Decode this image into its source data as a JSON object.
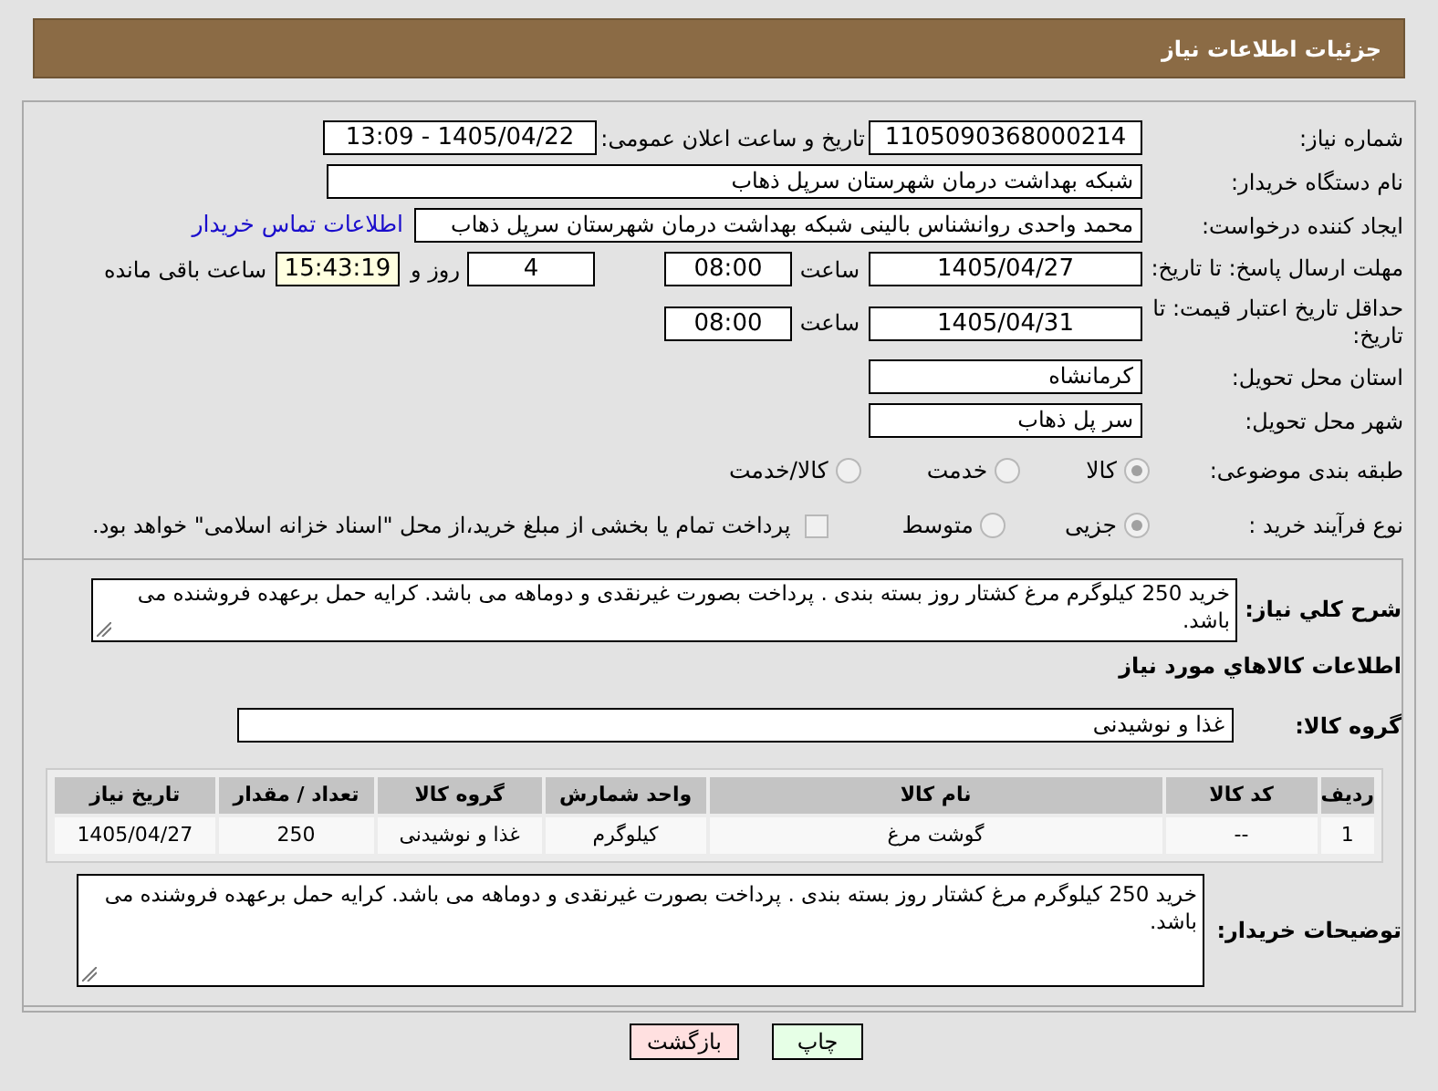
{
  "header": {
    "title": "جزئیات اطلاعات نیاز"
  },
  "need_number": {
    "label": "شماره نیاز:",
    "value": "1105090368000214"
  },
  "announce": {
    "label": "تاریخ و ساعت اعلان عمومی:",
    "value": "1405/04/22 - 13:09"
  },
  "buyer_org": {
    "label": "نام دستگاه خریدار:",
    "value": "شبکه بهداشت درمان شهرستان سرپل ذهاب"
  },
  "requester": {
    "label": "ایجاد کننده درخواست:",
    "value": "محمد واحدی روانشناس بالینی شبکه بهداشت درمان شهرستان سرپل ذهاب",
    "link": "اطلاعات تماس خریدار"
  },
  "reply_deadline": {
    "label": "مهلت ارسال پاسخ: تا تاریخ:",
    "date": "1405/04/27",
    "time_label": "ساعت",
    "time": "08:00",
    "days": "4",
    "days_label": "روز و",
    "remaining": "15:43:19",
    "remaining_label": "ساعت باقی مانده"
  },
  "price_validity": {
    "label": "حداقل تاریخ اعتبار قیمت: تا تاریخ:",
    "date": "1405/04/31",
    "time_label": "ساعت",
    "time": "08:00"
  },
  "province": {
    "label": "استان محل تحویل:",
    "value": "کرمانشاه"
  },
  "city": {
    "label": "شهر محل تحویل:",
    "value": "سر پل ذهاب"
  },
  "category": {
    "label": "طبقه بندی موضوعی:",
    "options": [
      {
        "label": "کالا",
        "selected": true
      },
      {
        "label": "خدمت",
        "selected": false
      },
      {
        "label": "کالا/خدمت",
        "selected": false
      }
    ]
  },
  "purchase_type": {
    "label": "نوع فرآیند خرید :",
    "options": [
      {
        "label": "جزیی",
        "selected": true
      },
      {
        "label": "متوسط",
        "selected": false
      }
    ],
    "treasury": {
      "label": "پرداخت تمام یا بخشی از مبلغ خرید،از محل \"اسناد خزانه اسلامی\" خواهد بود.",
      "checked": false
    }
  },
  "description": {
    "label": "شرح کلي نياز:",
    "value": "خرید 250 کیلوگرم مرغ کشتار روز بسته بندی . پرداخت بصورت غیرنقدی و دوماهه می باشد. کرایه حمل برعهده فروشنده می باشد."
  },
  "goods_title": "اطلاعات کالاهاي مورد نياز",
  "goods_group": {
    "label": "گروه کالا:",
    "value": "غذا و نوشیدنی"
  },
  "table": {
    "columns": [
      "ردیف",
      "کد کالا",
      "نام کالا",
      "واحد شمارش",
      "گروه کالا",
      "تعداد / مقدار",
      "تاریخ نیاز"
    ],
    "rows": [
      [
        "1",
        "--",
        "گوشت مرغ",
        "کیلوگرم",
        "غذا و نوشیدنی",
        "250",
        "1405/04/27"
      ]
    ]
  },
  "buyer_notes": {
    "label": "توضیحات خریدار:",
    "value": "خرید 250 کیلوگرم مرغ کشتار روز بسته بندی . پرداخت بصورت غیرنقدی و دوماهه می باشد. کرایه حمل برعهده فروشنده می باشد."
  },
  "buttons": [
    {
      "label": "چاپ",
      "kind": "print"
    },
    {
      "label": "بازگشت",
      "kind": "back"
    }
  ]
}
